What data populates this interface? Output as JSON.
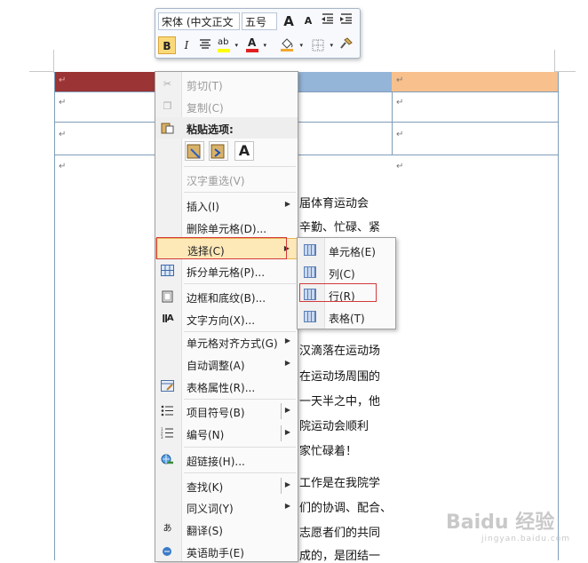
{
  "minibar": {
    "font": "宋体 (中文正文",
    "size": "五号",
    "grow_icon": "A",
    "shrink_icon": "A",
    "bold": "B",
    "italic": "I",
    "font_color_letter": "A",
    "highlight_label": "ab"
  },
  "menu": {
    "items": [
      {
        "label": "剪切(T)",
        "disabled": true,
        "icon": "scissors-icon"
      },
      {
        "label": "复制(C)",
        "disabled": true,
        "icon": "copy-icon"
      },
      {
        "label": "粘贴选项:",
        "bold": true,
        "icon": "paste-icon"
      },
      {
        "label": "汉字重选(V)",
        "disabled": true
      },
      {
        "label": "插入(I)",
        "submenu": true
      },
      {
        "label": "删除单元格(D)..."
      },
      {
        "label": "选择(C)",
        "submenu": true,
        "highlighted": true
      },
      {
        "label": "拆分单元格(P)...",
        "icon": "split-cells-icon"
      },
      {
        "label": "边框和底纹(B)...",
        "icon": "borders-icon"
      },
      {
        "label": "文字方向(X)...",
        "icon": "text-direction-icon"
      },
      {
        "label": "单元格对齐方式(G)",
        "submenu": true
      },
      {
        "label": "自动调整(A)",
        "submenu": true
      },
      {
        "label": "表格属性(R)...",
        "icon": "table-properties-icon"
      },
      {
        "label": "项目符号(B)",
        "submenu": true,
        "icon": "bullets-icon"
      },
      {
        "label": "编号(N)",
        "submenu": true,
        "icon": "numbering-icon"
      },
      {
        "label": "超链接(H)...",
        "icon": "hyperlink-icon"
      },
      {
        "label": "查找(K)",
        "submenu": true
      },
      {
        "label": "同义词(Y)",
        "submenu": true
      },
      {
        "label": "翻译(S)",
        "icon": "translate-icon"
      },
      {
        "label": "英语助手(E)",
        "icon": "english-assistant-icon"
      }
    ],
    "paste_text_only": "A"
  },
  "submenu": {
    "items": [
      {
        "label": "单元格(E)"
      },
      {
        "label": "列(C)"
      },
      {
        "label": "行(R)",
        "boxed": true
      },
      {
        "label": "表格(T)"
      }
    ]
  },
  "doc": {
    "lines": [
      "届体育运动会",
      "辛勤、忙碌、紧",
      "汉滴落在运动场",
      "在运动场周围的",
      "一天半之中，他",
      "院运动会顺利",
      "家忙碌着！",
      "工作是在我院学",
      "们的协调、配合、",
      "志愿者们的共同",
      "成的，是团结一"
    ]
  },
  "colors": {
    "cell_red": "#9b3434",
    "cell_blue": "#94b4d8",
    "cell_orange": "#f8c08c",
    "menu_highlight": "#fde8b8",
    "red_box": "#d23a3a"
  },
  "watermark": {
    "text": "Baidu 经验",
    "sub": "jingyan.baidu.com"
  }
}
